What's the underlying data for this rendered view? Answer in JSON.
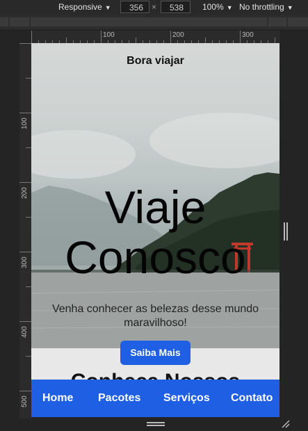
{
  "devtools": {
    "device_mode": "Responsive",
    "width": "356",
    "height": "538",
    "times": "×",
    "zoom": "100%",
    "throttling": "No throttling",
    "ruler_h_labels": [
      "100",
      "200",
      "300"
    ],
    "ruler_v_labels": [
      "100",
      "200",
      "300",
      "400",
      "500"
    ]
  },
  "site": {
    "brand": "Bora viajar",
    "hero_title_line1": "Viaje",
    "hero_title_line2": "Conosco",
    "hero_subtitle": "Venha conhecer as belezas desse mundo maravilhoso!",
    "cta_label": "Saiba Mais",
    "section_title": "Conheça Nossos",
    "nav": [
      "Home",
      "Pacotes",
      "Serviços",
      "Contato"
    ],
    "accent_color": "#1f5fe3"
  }
}
